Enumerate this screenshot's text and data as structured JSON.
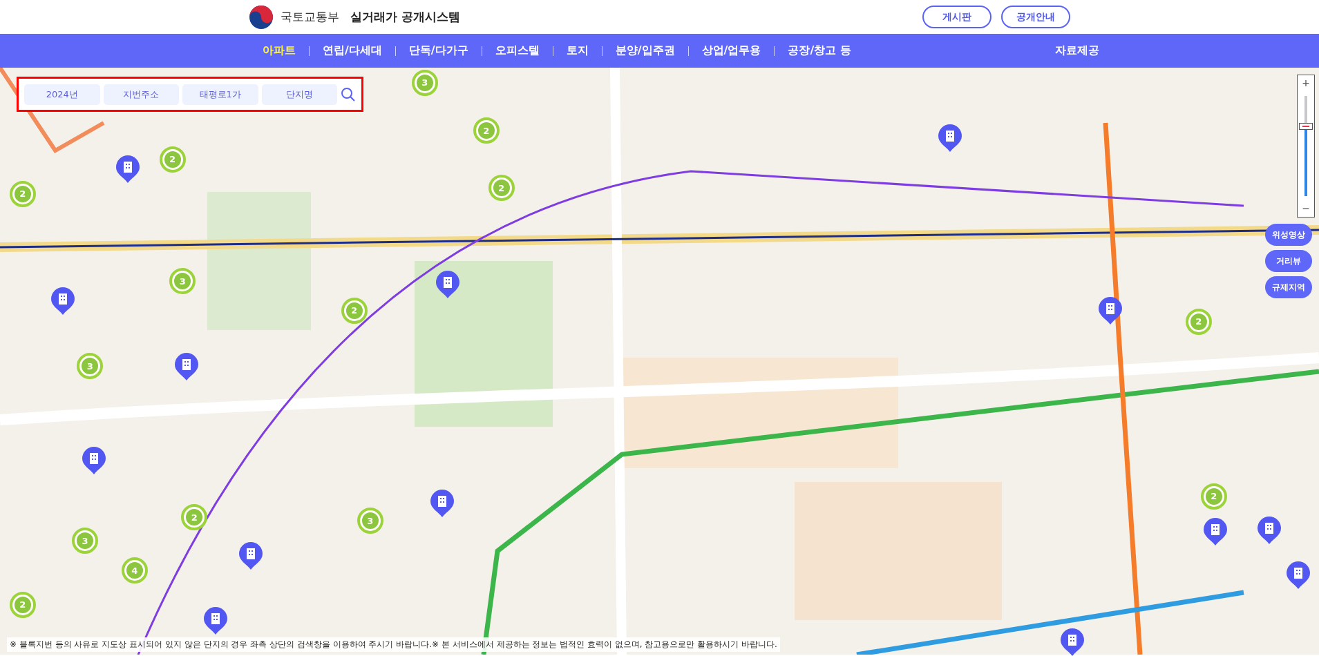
{
  "header": {
    "ministry": "국토교통부",
    "title": "실거래가 공개시스템",
    "buttons": [
      "게시판",
      "공개안내"
    ]
  },
  "nav": {
    "items": [
      {
        "label": "아파트",
        "selected": true
      },
      {
        "label": "연립/다세대",
        "selected": false
      },
      {
        "label": "단독/다가구",
        "selected": false
      },
      {
        "label": "오피스텔",
        "selected": false
      },
      {
        "label": "토지",
        "selected": false
      },
      {
        "label": "분양/입주권",
        "selected": false
      },
      {
        "label": "상업/업무용",
        "selected": false
      },
      {
        "label": "공장/창고 등",
        "selected": false
      }
    ],
    "extra": "자료제공"
  },
  "search": {
    "filters": [
      "2024년",
      "지번주소",
      "태평로1가",
      "단지명"
    ]
  },
  "map": {
    "kind": "picture",
    "zoom": {
      "plus": "+",
      "minus": "−",
      "level": 0.7
    },
    "layer_buttons": [
      "위성영상",
      "거리뷰",
      "규제지역"
    ],
    "markers": [
      {
        "kind": "cluster",
        "count": "3"
      },
      {
        "kind": "cluster",
        "count": "2"
      },
      {
        "kind": "cluster",
        "count": "2"
      },
      {
        "kind": "cluster",
        "count": "2"
      },
      {
        "kind": "cluster",
        "count": "2"
      },
      {
        "kind": "cluster",
        "count": "3"
      },
      {
        "kind": "cluster",
        "count": "2"
      },
      {
        "kind": "cluster",
        "count": "3"
      },
      {
        "kind": "cluster",
        "count": "2"
      },
      {
        "kind": "cluster",
        "count": "2"
      },
      {
        "kind": "cluster",
        "count": "3"
      },
      {
        "kind": "cluster",
        "count": "3"
      },
      {
        "kind": "cluster",
        "count": "4"
      },
      {
        "kind": "cluster",
        "count": "2"
      },
      {
        "kind": "cluster",
        "count": "2"
      },
      {
        "kind": "building"
      },
      {
        "kind": "building"
      },
      {
        "kind": "building"
      },
      {
        "kind": "building"
      },
      {
        "kind": "building"
      },
      {
        "kind": "building"
      },
      {
        "kind": "building"
      },
      {
        "kind": "building"
      },
      {
        "kind": "building"
      },
      {
        "kind": "building"
      },
      {
        "kind": "building"
      },
      {
        "kind": "building"
      },
      {
        "kind": "building"
      },
      {
        "kind": "building"
      }
    ]
  },
  "notice": "※ 블록지번 등의 사유로 지도상 표시되어 있지 않은 단지의 경우 좌측 상단의 검색창을 이용하여 주시기 바랍니다.※ 본 서비스에서 제공하는 정보는 법적인 효력이 없으며, 참고용으로만 활용하시기 바랍니다."
}
